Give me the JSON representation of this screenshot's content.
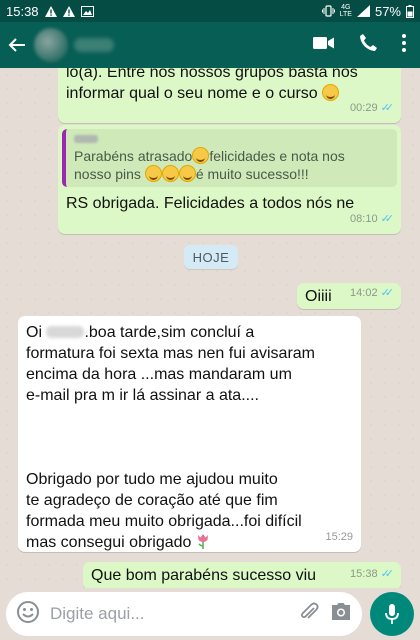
{
  "status_bar": {
    "time": "15:38",
    "battery": "57%",
    "network_4g": "4G",
    "network_lte": "LTE"
  },
  "header": {
    "video_icon": "video-call-icon",
    "call_icon": "phone-icon",
    "menu_icon": "more-vert-icon"
  },
  "messages": [
    {
      "text_1": "lo(a). Entre nos nossos grupos basta nos",
      "text_2": "informar qual o seu nome e o curso",
      "time": "00:29"
    },
    {
      "quote_text_1": "Parabéns atrasado",
      "quote_text_2": "felicidades e nota nos",
      "quote_text_3": "nosso pins",
      "quote_text_4": "é muito sucesso!!!",
      "text": "RS obrigada. Felicidades a todos nós ne",
      "time": "08:10"
    },
    {
      "text": "Oiiii",
      "time": "14:02"
    },
    {
      "line_1a": "Oi",
      "line_1b": ".boa tarde,sim concluí a",
      "line_2": "formatura foi sexta mas nen fui avisaram",
      "line_3": "encima da hora ...mas mandaram um",
      "line_4": "e-mail pra m ir lá assinar  a ata....",
      "line_5": "Obrigado por tudo me ajudou muito",
      "line_6": "te agradeço  de coração  até que fim",
      "line_7": "formada meu muito obrigada...foi difícil",
      "line_8": "mas consegui obrigado",
      "time": "15:29"
    },
    {
      "text": "Que bom parabéns sucesso viu",
      "time": "15:38"
    }
  ],
  "day_chip": "HOJE",
  "composer": {
    "placeholder": "Digite aqui...",
    "emoji_icon": "emoji-icon",
    "attach_icon": "paperclip-icon",
    "camera_icon": "camera-icon",
    "mic_icon": "mic-icon"
  },
  "colors": {
    "header": "#075e54",
    "outgoing": "#dcf8c6",
    "incoming": "#ffffff",
    "accent": "#00897b",
    "read_ticks": "#4fc3f7"
  }
}
